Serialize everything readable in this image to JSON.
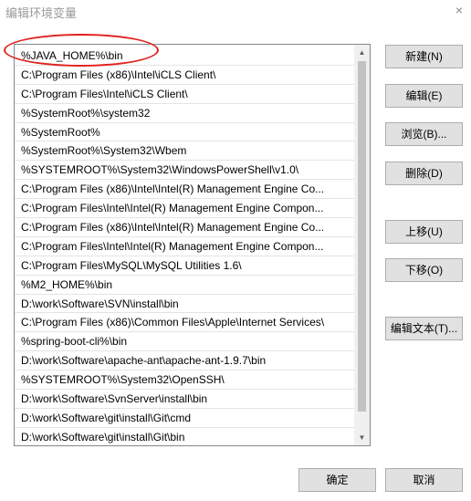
{
  "window": {
    "title": "编辑环境变量",
    "close_glyph": "×"
  },
  "list": {
    "items": [
      "%JAVA_HOME%\\bin",
      "C:\\Program Files (x86)\\Intel\\iCLS Client\\",
      "C:\\Program Files\\Intel\\iCLS Client\\",
      "%SystemRoot%\\system32",
      "%SystemRoot%",
      "%SystemRoot%\\System32\\Wbem",
      "%SYSTEMROOT%\\System32\\WindowsPowerShell\\v1.0\\",
      "C:\\Program Files (x86)\\Intel\\Intel(R) Management Engine Co...",
      "C:\\Program Files\\Intel\\Intel(R) Management Engine Compon...",
      "C:\\Program Files (x86)\\Intel\\Intel(R) Management Engine Co...",
      "C:\\Program Files\\Intel\\Intel(R) Management Engine Compon...",
      "C:\\Program Files\\MySQL\\MySQL Utilities 1.6\\",
      "%M2_HOME%\\bin",
      "D:\\work\\Software\\SVN\\install\\bin",
      "C:\\Program Files (x86)\\Common Files\\Apple\\Internet Services\\",
      "%spring-boot-cli%\\bin",
      "D:\\work\\Software\\apache-ant\\apache-ant-1.9.7\\bin",
      "%SYSTEMROOT%\\System32\\OpenSSH\\",
      "D:\\work\\Software\\SvnServer\\install\\bin",
      "D:\\work\\Software\\git\\install\\Git\\cmd",
      "D:\\work\\Software\\git\\install\\Git\\bin"
    ],
    "selected_index": 0,
    "scroll_up_glyph": "▲",
    "scroll_down_glyph": "▼"
  },
  "buttons": {
    "new": "新建(N)",
    "edit": "编辑(E)",
    "browse": "浏览(B)...",
    "delete": "删除(D)",
    "move_up": "上移(U)",
    "move_down": "下移(O)",
    "edit_text": "编辑文本(T)...",
    "ok": "确定",
    "cancel": "取消"
  },
  "colors": {
    "annotation": "#e0221d",
    "button_bg": "#e1e1e1",
    "title_text": "#9a9a9a"
  }
}
